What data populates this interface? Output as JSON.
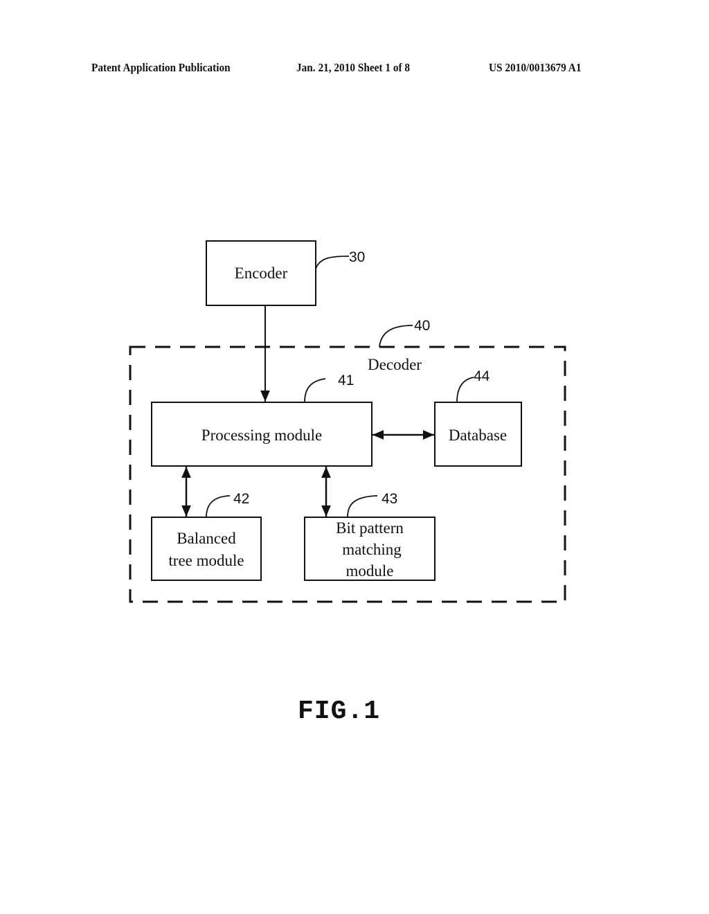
{
  "header": {
    "left": "Patent Application Publication",
    "middle": "Jan. 21, 2010  Sheet 1 of 8",
    "right": "US 2010/0013679 A1"
  },
  "diagram": {
    "nodes": {
      "encoder": {
        "label": "Encoder",
        "ref": "30"
      },
      "decoder": {
        "label": "Decoder",
        "ref": "40"
      },
      "processing_module": {
        "label": "Processing module",
        "ref": "41"
      },
      "balanced_tree_module": {
        "label_lines": [
          "Balanced",
          "tree module"
        ],
        "ref": "42"
      },
      "bit_pattern_matching_module": {
        "label_lines": [
          "Bit pattern",
          "matching",
          "module"
        ],
        "ref": "43"
      },
      "database": {
        "label": "Database",
        "ref": "44"
      }
    },
    "edges": [
      {
        "from": "Encoder",
        "to": "Processing module",
        "direction": "one-way"
      },
      {
        "from": "Processing module",
        "to": "Database",
        "direction": "bidirectional"
      },
      {
        "from": "Processing module",
        "to": "Balanced tree module",
        "direction": "bidirectional"
      },
      {
        "from": "Processing module",
        "to": "Bit pattern matching module",
        "direction": "bidirectional"
      }
    ]
  },
  "figure_label": "FIG.1"
}
